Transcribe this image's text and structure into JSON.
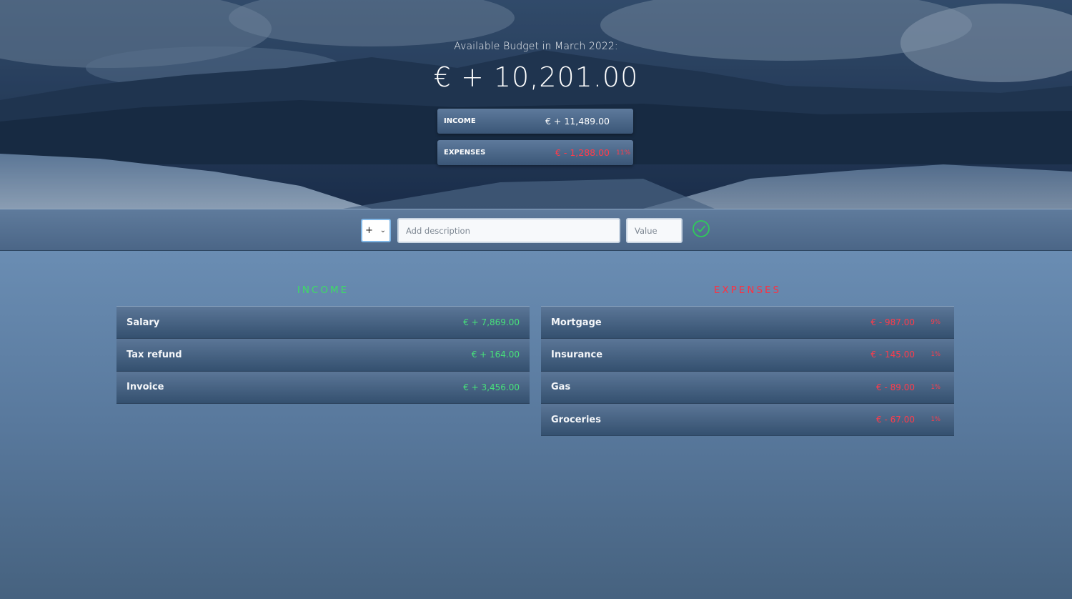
{
  "header": {
    "title": "Available Budget in March 2022:",
    "budget": "€ + 10,201.00"
  },
  "summary": {
    "income": {
      "label": "INCOME",
      "value": "€ + 11,489.00"
    },
    "expenses": {
      "label": "EXPENSES",
      "value": "€ - 1,288.00",
      "percent": "11%"
    }
  },
  "add_form": {
    "type_value": "+",
    "description_placeholder": "Add description",
    "value_placeholder": "Value"
  },
  "income_list": {
    "heading": "INCOME",
    "items": [
      {
        "name": "Salary",
        "amount": "€ + 7,869.00"
      },
      {
        "name": "Tax refund",
        "amount": "€ + 164.00"
      },
      {
        "name": "Invoice",
        "amount": "€ + 3,456.00"
      }
    ]
  },
  "expenses_list": {
    "heading": "EXPENSES",
    "items": [
      {
        "name": "Mortgage",
        "amount": "€ - 987.00",
        "percent": "9%"
      },
      {
        "name": "Insurance",
        "amount": "€ - 145.00",
        "percent": "1%"
      },
      {
        "name": "Gas",
        "amount": "€ - 89.00",
        "percent": "1%"
      },
      {
        "name": "Groceries",
        "amount": "€ - 67.00",
        "percent": "1%"
      }
    ]
  },
  "colors": {
    "income": "#3ddc65",
    "expense": "#ff3b4a",
    "accept": "#2ecc5a"
  },
  "icons": {
    "add_button": "check-circle-icon",
    "select_arrow": "chevron-down-icon"
  }
}
